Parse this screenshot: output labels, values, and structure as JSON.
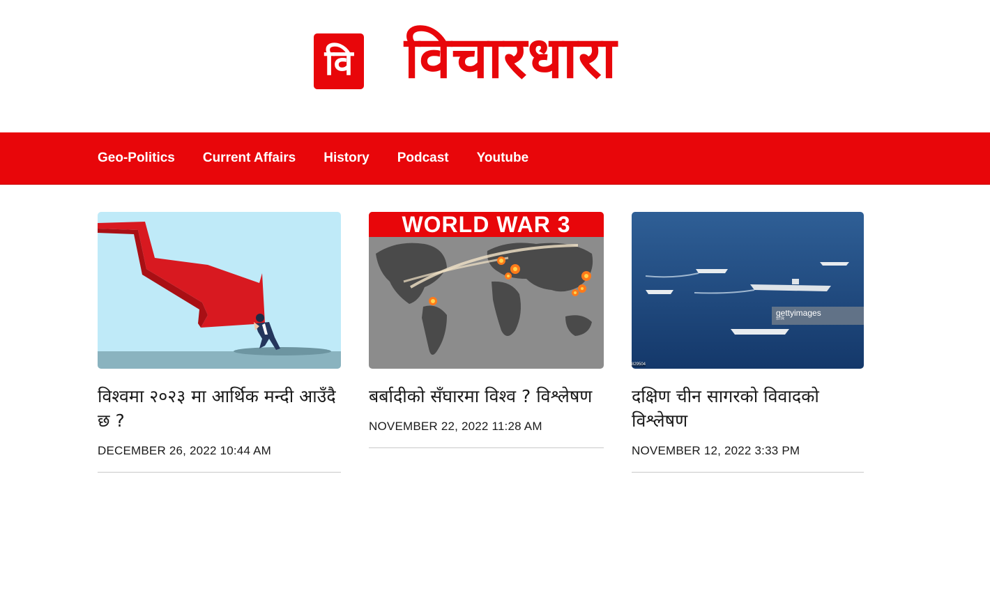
{
  "brand": {
    "logo_letter": "वि",
    "site_name": "विचारधारा",
    "accent_color": "#e8060a"
  },
  "nav": {
    "items": [
      {
        "label": "Geo-Politics"
      },
      {
        "label": "Current Affairs"
      },
      {
        "label": "History"
      },
      {
        "label": "Podcast"
      },
      {
        "label": "Youtube"
      }
    ]
  },
  "articles": [
    {
      "title": "विश्वमा २०२३ मा आर्थिक मन्दी आउँदै छ ?",
      "date": "December 26, 2022 10:44 AM",
      "image": "falling-arrow-recession-illustration"
    },
    {
      "title": "बर्बादीको सँघारमा विश्व ? विश्लेषण",
      "date": "November 22, 2022 11:28 AM",
      "image": "world-war-map",
      "image_banner": "WORLD WAR 3"
    },
    {
      "title": "दक्षिण चीन सागरको विवादको विश्लेषण",
      "date": "November 12, 2022 3:33 PM",
      "image": "naval-fleet-photo",
      "watermark": "gettyimages",
      "watermark_sub": "STR",
      "photo_id": "829504"
    }
  ]
}
